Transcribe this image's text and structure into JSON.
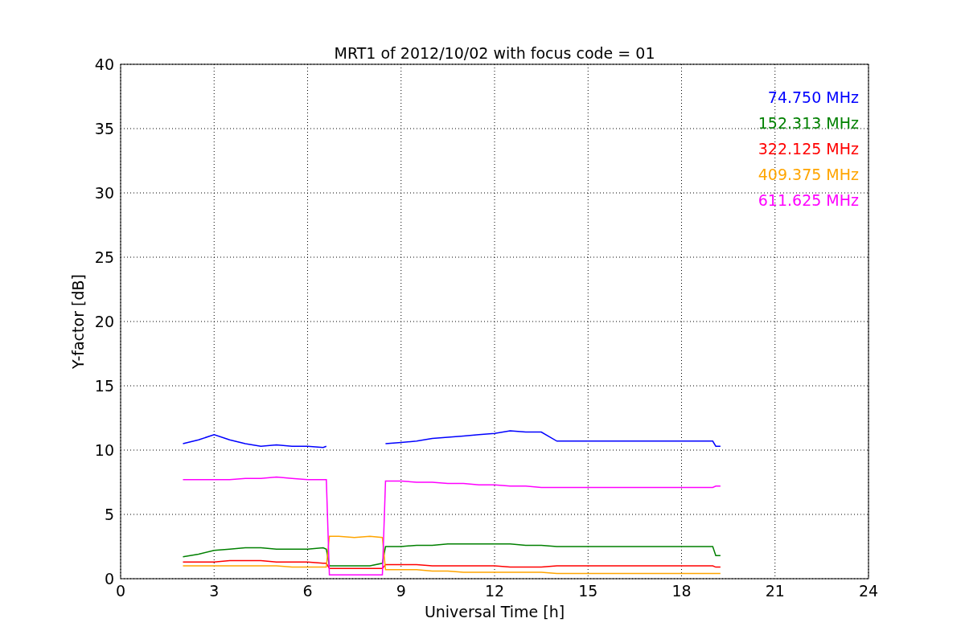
{
  "figure": {
    "chart_data": {
      "type": "line",
      "title": "MRT1 of 2012/10/02 with focus code = 01",
      "xlabel": "Universal Time [h]",
      "ylabel": "Y-factor [dB]",
      "x": [
        2,
        2.5,
        3,
        3.5,
        4,
        4.5,
        5,
        5.5,
        6,
        6.5,
        6.6,
        6.7,
        7,
        7.5,
        8,
        8.4,
        8.5,
        9,
        9.5,
        10,
        10.5,
        11,
        11.5,
        12,
        12.5,
        13,
        13.5,
        14,
        19,
        19.1,
        19.25
      ],
      "series": [
        {
          "name": "74.750 MHz",
          "color": "#0000ff",
          "values": [
            10.5,
            10.8,
            11.2,
            10.8,
            10.5,
            10.3,
            10.4,
            10.3,
            10.3,
            10.2,
            10.3,
            null,
            null,
            null,
            null,
            null,
            10.5,
            10.6,
            10.7,
            10.9,
            11,
            11.1,
            11.2,
            11.3,
            11.5,
            11.4,
            11.4,
            10.7,
            10.7,
            10.3,
            10.3
          ]
        },
        {
          "name": "152.313 MHz",
          "color": "#008000",
          "values": [
            1.7,
            1.9,
            2.2,
            2.3,
            2.4,
            2.4,
            2.3,
            2.3,
            2.3,
            2.4,
            2.3,
            1,
            1,
            1,
            1,
            1.2,
            2.5,
            2.5,
            2.6,
            2.6,
            2.7,
            2.7,
            2.7,
            2.7,
            2.7,
            2.6,
            2.6,
            2.5,
            2.5,
            1.8,
            1.8
          ]
        },
        {
          "name": "322.125 MHz",
          "color": "#ff0000",
          "values": [
            1.3,
            1.3,
            1.3,
            1.4,
            1.4,
            1.4,
            1.3,
            1.3,
            1.3,
            1.2,
            1.2,
            0.8,
            0.8,
            0.8,
            0.8,
            0.8,
            1.1,
            1.1,
            1.1,
            1.0,
            1.0,
            1.0,
            1.0,
            1.0,
            0.9,
            0.9,
            0.9,
            1.0,
            1.0,
            0.9,
            0.9
          ]
        },
        {
          "name": "409.375 MHz",
          "color": "#ffa500",
          "values": [
            1.0,
            1.0,
            1.0,
            1.0,
            1.0,
            1.0,
            1.0,
            0.9,
            0.9,
            0.9,
            0.9,
            3.3,
            3.3,
            3.2,
            3.3,
            3.2,
            0.7,
            0.7,
            0.7,
            0.6,
            0.6,
            0.5,
            0.5,
            0.5,
            0.5,
            0.5,
            0.5,
            0.4,
            0.4,
            0.4,
            0.4
          ]
        },
        {
          "name": "611.625 MHz",
          "color": "#ff00ff",
          "values": [
            7.7,
            7.7,
            7.7,
            7.7,
            7.8,
            7.8,
            7.9,
            7.8,
            7.7,
            7.7,
            7.7,
            0.3,
            0.3,
            0.3,
            0.3,
            0.3,
            7.6,
            7.6,
            7.5,
            7.5,
            7.4,
            7.4,
            7.3,
            7.3,
            7.2,
            7.2,
            7.1,
            7.1,
            7.1,
            7.2,
            7.2
          ]
        }
      ],
      "xlim": [
        0,
        24
      ],
      "ylim": [
        0,
        40
      ],
      "xticks": [
        0,
        3,
        6,
        9,
        12,
        15,
        18,
        21,
        24
      ],
      "yticks": [
        0,
        5,
        10,
        15,
        20,
        25,
        30,
        35,
        40
      ],
      "grid": true
    }
  }
}
